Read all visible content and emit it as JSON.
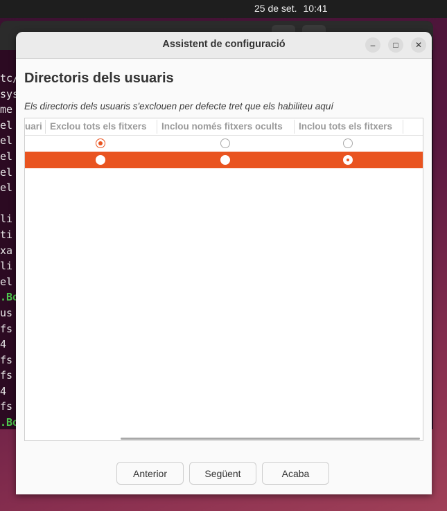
{
  "topbar": {
    "date": "25 de set.",
    "time": "10:41"
  },
  "terminal": {
    "lines": [
      "tc/",
      "sys",
      "me",
      "el",
      "el",
      "el",
      "el",
      "el",
      "",
      "li",
      "ti",
      "xa",
      "li",
      "el",
      ".Bo",
      "us",
      "fs",
      "4",
      "fs",
      "fs",
      "4",
      "fs",
      ".Bo"
    ]
  },
  "dialog": {
    "title": "Assistent de configuració",
    "heading": "Directoris dels usuaris",
    "subtitle": "Els directoris dels usuaris s'exclouen per defecte tret que els habiliteu aquí",
    "columns": [
      "uari",
      "Exclou tots els fitxers",
      "Inclou només fitxers ocults",
      "Inclou tots els fitxers"
    ],
    "rows": [
      {
        "selected": false,
        "choice": 0
      },
      {
        "selected": true,
        "choice": 2
      }
    ],
    "buttons": {
      "previous": "Anterior",
      "next": "Següent",
      "finish": "Acaba"
    },
    "window_controls": {
      "minimize": "–",
      "maximize": "□",
      "close": "✕"
    },
    "accent_color": "#e95420"
  }
}
